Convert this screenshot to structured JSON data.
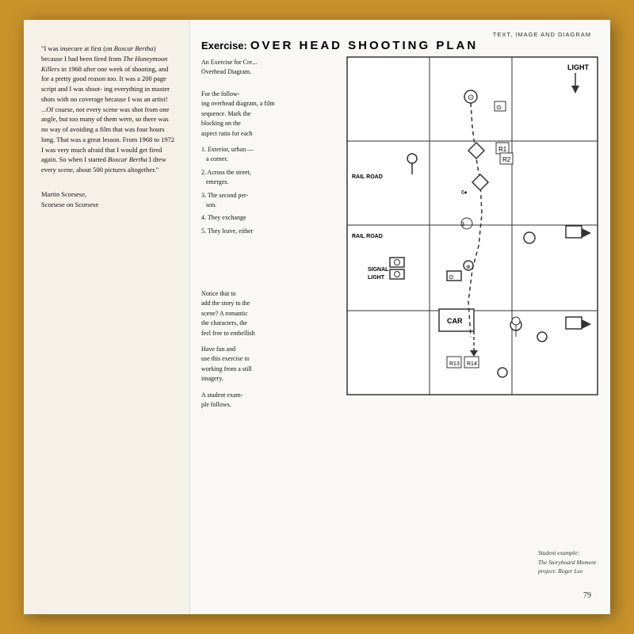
{
  "page": {
    "header_right": "TEXT, IMAGE AND DIAGRAM",
    "page_number": "79",
    "left_quote": "\"I was insecure at first (on Boxcar Bertha) because I had been fired from The Honeymoon Killers in 1968 after one week of shooting, and for a pretty good reason too. It was a 200 page script and I was shooting everything in master shots with no coverage because I was an artist! ...Of course, not every scene was shot from one angle, but too many of them were, so there was no way of avoiding a film that was four hours long. That was a great lesson. From 1968 to 1972 I was very much afraid that I would get fired again. So when I started Boxcar Bertha I drew every scene, about 500 pictures altogether.\"",
    "attribution_name": "Martin Scorsese,",
    "attribution_source": "Scorsese on Scorsese",
    "exercise_label": "Exercise:",
    "overhead_title": "OVER HEAD SHOOTING    PLAN",
    "exercise_subtitle_1": "An Exercise for Cre",
    "exercise_subtitle_2": "Overhead Diagram.",
    "body_para_1": "For the following overhead diagram, a film sequence. Mark the blocking on the aspect ratio for each",
    "numbered_items": [
      "1. Exterior, urban — a corner.",
      "2. Across the street, emerges.",
      "3. The second person.",
      "4. They exchange",
      "5. They leave, either"
    ],
    "notice_para": "Notice that to add the story to the scene? A romantic characters, the feel free to embellish",
    "have_fun_para": "Have fun and use this exercise to working from a still imagery.",
    "student_note": "A student example follows.",
    "caption_line1": "Student example:",
    "caption_line2": "The Storyboard Moment",
    "caption_line3": "project: Roger Lee",
    "diagram": {
      "rail_road_1": "RAIL ROAD",
      "rail_road_2": "RAIL ROAD",
      "signal_light": "SIGNAL\nLIGHT",
      "car_label": "CAR",
      "light_label": "LIGHT"
    }
  }
}
